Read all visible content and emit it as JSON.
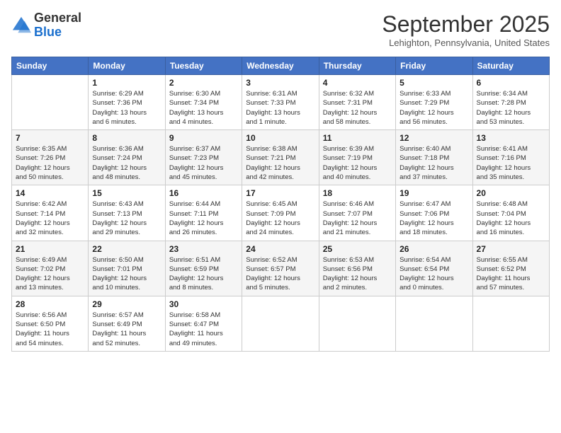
{
  "logo": {
    "general": "General",
    "blue": "Blue"
  },
  "header": {
    "month": "September 2025",
    "location": "Lehighton, Pennsylvania, United States"
  },
  "weekdays": [
    "Sunday",
    "Monday",
    "Tuesday",
    "Wednesday",
    "Thursday",
    "Friday",
    "Saturday"
  ],
  "weeks": [
    [
      {
        "day": "",
        "info": ""
      },
      {
        "day": "1",
        "info": "Sunrise: 6:29 AM\nSunset: 7:36 PM\nDaylight: 13 hours\nand 6 minutes."
      },
      {
        "day": "2",
        "info": "Sunrise: 6:30 AM\nSunset: 7:34 PM\nDaylight: 13 hours\nand 4 minutes."
      },
      {
        "day": "3",
        "info": "Sunrise: 6:31 AM\nSunset: 7:33 PM\nDaylight: 13 hours\nand 1 minute."
      },
      {
        "day": "4",
        "info": "Sunrise: 6:32 AM\nSunset: 7:31 PM\nDaylight: 12 hours\nand 58 minutes."
      },
      {
        "day": "5",
        "info": "Sunrise: 6:33 AM\nSunset: 7:29 PM\nDaylight: 12 hours\nand 56 minutes."
      },
      {
        "day": "6",
        "info": "Sunrise: 6:34 AM\nSunset: 7:28 PM\nDaylight: 12 hours\nand 53 minutes."
      }
    ],
    [
      {
        "day": "7",
        "info": "Sunrise: 6:35 AM\nSunset: 7:26 PM\nDaylight: 12 hours\nand 50 minutes."
      },
      {
        "day": "8",
        "info": "Sunrise: 6:36 AM\nSunset: 7:24 PM\nDaylight: 12 hours\nand 48 minutes."
      },
      {
        "day": "9",
        "info": "Sunrise: 6:37 AM\nSunset: 7:23 PM\nDaylight: 12 hours\nand 45 minutes."
      },
      {
        "day": "10",
        "info": "Sunrise: 6:38 AM\nSunset: 7:21 PM\nDaylight: 12 hours\nand 42 minutes."
      },
      {
        "day": "11",
        "info": "Sunrise: 6:39 AM\nSunset: 7:19 PM\nDaylight: 12 hours\nand 40 minutes."
      },
      {
        "day": "12",
        "info": "Sunrise: 6:40 AM\nSunset: 7:18 PM\nDaylight: 12 hours\nand 37 minutes."
      },
      {
        "day": "13",
        "info": "Sunrise: 6:41 AM\nSunset: 7:16 PM\nDaylight: 12 hours\nand 35 minutes."
      }
    ],
    [
      {
        "day": "14",
        "info": "Sunrise: 6:42 AM\nSunset: 7:14 PM\nDaylight: 12 hours\nand 32 minutes."
      },
      {
        "day": "15",
        "info": "Sunrise: 6:43 AM\nSunset: 7:13 PM\nDaylight: 12 hours\nand 29 minutes."
      },
      {
        "day": "16",
        "info": "Sunrise: 6:44 AM\nSunset: 7:11 PM\nDaylight: 12 hours\nand 26 minutes."
      },
      {
        "day": "17",
        "info": "Sunrise: 6:45 AM\nSunset: 7:09 PM\nDaylight: 12 hours\nand 24 minutes."
      },
      {
        "day": "18",
        "info": "Sunrise: 6:46 AM\nSunset: 7:07 PM\nDaylight: 12 hours\nand 21 minutes."
      },
      {
        "day": "19",
        "info": "Sunrise: 6:47 AM\nSunset: 7:06 PM\nDaylight: 12 hours\nand 18 minutes."
      },
      {
        "day": "20",
        "info": "Sunrise: 6:48 AM\nSunset: 7:04 PM\nDaylight: 12 hours\nand 16 minutes."
      }
    ],
    [
      {
        "day": "21",
        "info": "Sunrise: 6:49 AM\nSunset: 7:02 PM\nDaylight: 12 hours\nand 13 minutes."
      },
      {
        "day": "22",
        "info": "Sunrise: 6:50 AM\nSunset: 7:01 PM\nDaylight: 12 hours\nand 10 minutes."
      },
      {
        "day": "23",
        "info": "Sunrise: 6:51 AM\nSunset: 6:59 PM\nDaylight: 12 hours\nand 8 minutes."
      },
      {
        "day": "24",
        "info": "Sunrise: 6:52 AM\nSunset: 6:57 PM\nDaylight: 12 hours\nand 5 minutes."
      },
      {
        "day": "25",
        "info": "Sunrise: 6:53 AM\nSunset: 6:56 PM\nDaylight: 12 hours\nand 2 minutes."
      },
      {
        "day": "26",
        "info": "Sunrise: 6:54 AM\nSunset: 6:54 PM\nDaylight: 12 hours\nand 0 minutes."
      },
      {
        "day": "27",
        "info": "Sunrise: 6:55 AM\nSunset: 6:52 PM\nDaylight: 11 hours\nand 57 minutes."
      }
    ],
    [
      {
        "day": "28",
        "info": "Sunrise: 6:56 AM\nSunset: 6:50 PM\nDaylight: 11 hours\nand 54 minutes."
      },
      {
        "day": "29",
        "info": "Sunrise: 6:57 AM\nSunset: 6:49 PM\nDaylight: 11 hours\nand 52 minutes."
      },
      {
        "day": "30",
        "info": "Sunrise: 6:58 AM\nSunset: 6:47 PM\nDaylight: 11 hours\nand 49 minutes."
      },
      {
        "day": "",
        "info": ""
      },
      {
        "day": "",
        "info": ""
      },
      {
        "day": "",
        "info": ""
      },
      {
        "day": "",
        "info": ""
      }
    ]
  ]
}
